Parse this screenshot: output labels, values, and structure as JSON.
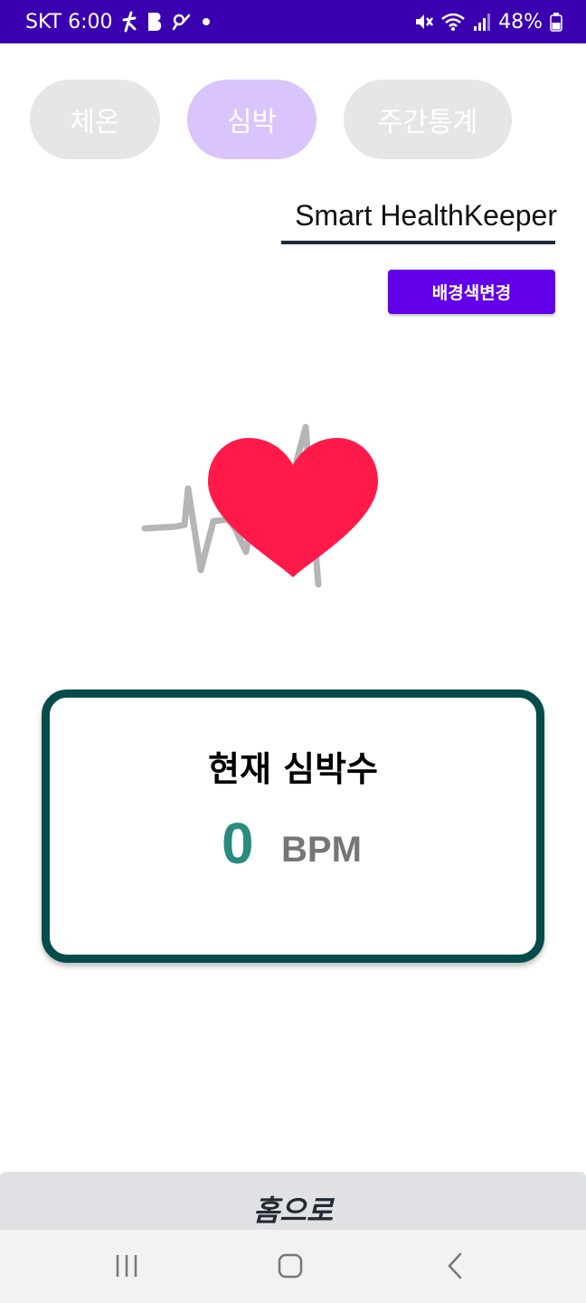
{
  "status_bar": {
    "carrier_time": "SKT 6:00",
    "notification_icons": [
      "figure-icon",
      "b-app-icon",
      "link-icon",
      "dot-icon"
    ],
    "battery": "48%",
    "system_icons": [
      "mute-icon",
      "wifi-icon",
      "signal-icon",
      "battery-icon"
    ]
  },
  "tabs": [
    {
      "label": "체온",
      "active": false
    },
    {
      "label": "심박",
      "active": true
    },
    {
      "label": "주간통계",
      "active": false
    }
  ],
  "app_title": "Smart HealthKeeper",
  "bg_button_label": "배경색변경",
  "heart_rate_card": {
    "title": "현재 심박수",
    "value": "0",
    "unit": "BPM"
  },
  "home_button_label": "홈으로",
  "colors": {
    "status_bar": "#3a00b0",
    "accent": "#6200ea",
    "active_tab": "#d9c5fb",
    "inactive_tab": "#e6e6e6",
    "heart": "#ff1a4a",
    "card_border": "#064c4a",
    "bpm_value": "#2a8a80"
  },
  "nav_bar": {
    "buttons": [
      "recent-apps-icon",
      "home-icon",
      "back-icon"
    ]
  }
}
